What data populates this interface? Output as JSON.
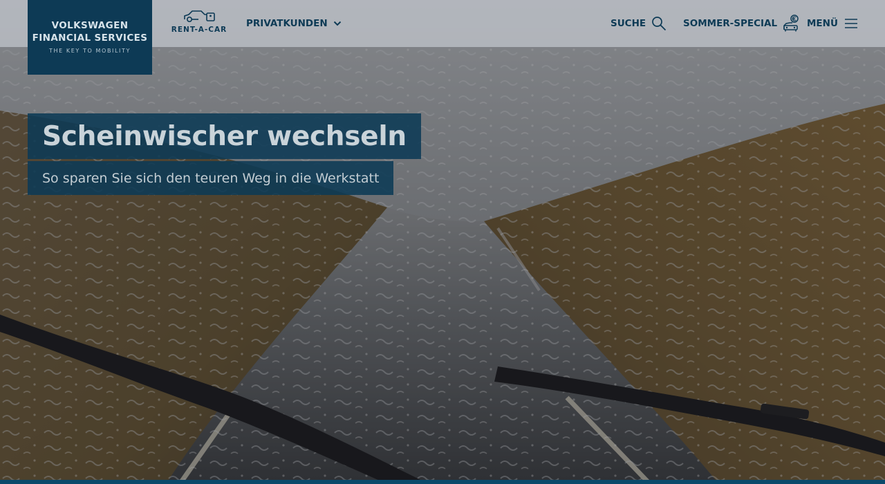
{
  "brand": {
    "line1": "VOLKSWAGEN",
    "line2": "FINANCIAL SERVICES",
    "tagline": "THE KEY TO MOBILITY",
    "color": "#0d3a55"
  },
  "header": {
    "rent_a_car_label": "RENT-A-CAR",
    "nav": {
      "privatkunden": "PRIVATKUNDEN",
      "suche": "SUCHE",
      "sommer_special": "SOMMER-SPECIAL",
      "menu": "MENÜ"
    },
    "icons": {
      "rent_a_car": "car-key-icon",
      "privatkunden": "chevron-down-icon",
      "suche": "search-icon",
      "sommer_special": "car-euro-icon",
      "menu": "hamburger-menu-icon"
    }
  },
  "hero": {
    "title": "Scheinwischer wechseln",
    "subtitle": "So sparen Sie sich den teuren Weg in die Werkstatt",
    "background": "rainy-windshield-road-photo"
  },
  "colors": {
    "accent": "#0d3a55",
    "header_bg": "#c4c8ce",
    "bottom_strip": "#0b4a6b"
  }
}
